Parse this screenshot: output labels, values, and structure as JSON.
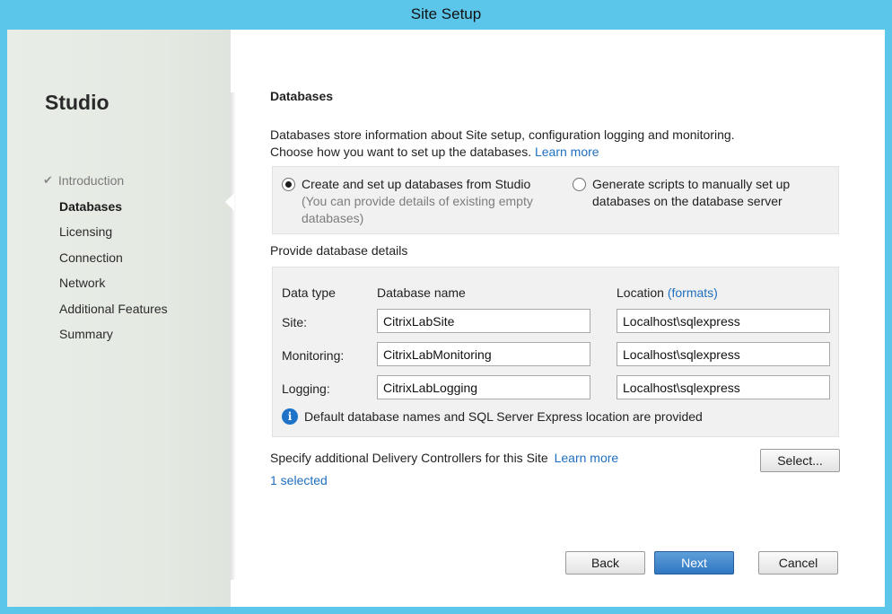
{
  "window": {
    "title": "Site Setup"
  },
  "sidebar": {
    "brand": "Studio",
    "items": [
      {
        "label": "Introduction",
        "state": "done"
      },
      {
        "label": "Databases",
        "state": "active"
      },
      {
        "label": "Licensing",
        "state": "pending"
      },
      {
        "label": "Connection",
        "state": "pending"
      },
      {
        "label": "Network",
        "state": "pending"
      },
      {
        "label": "Additional Features",
        "state": "pending"
      },
      {
        "label": "Summary",
        "state": "pending"
      }
    ],
    "check_glyph": "✔"
  },
  "main": {
    "title": "Databases",
    "intro_line1": "Databases store information about Site setup, configuration logging and monitoring.",
    "intro_line2": "Choose how you want to set up the databases.",
    "intro_link": "Learn more",
    "options": [
      {
        "label": "Create and set up databases from Studio",
        "sub": "(You can provide details of existing empty databases)",
        "selected": true
      },
      {
        "label": "Generate scripts to manually set up databases on the database server",
        "selected": false
      }
    ],
    "details_label": "Provide database details",
    "table": {
      "headers": {
        "type": "Data type",
        "name": "Database name",
        "location": "Location",
        "formats_link": "(formats)"
      },
      "rows": [
        {
          "label": "Site:",
          "name": "CitrixLabSite",
          "location": "Localhost\\sqlexpress"
        },
        {
          "label": "Monitoring:",
          "name": "CitrixLabMonitoring",
          "location": "Localhost\\sqlexpress"
        },
        {
          "label": "Logging:",
          "name": "CitrixLabLogging",
          "location": "Localhost\\sqlexpress"
        }
      ],
      "info": "Default database names and SQL Server Express location are provided",
      "info_glyph": "i"
    },
    "controllers_label": "Specify additional Delivery Controllers for this Site",
    "controllers_link": "Learn more",
    "select_button": "Select...",
    "selected_count": "1 selected"
  },
  "footer": {
    "back": "Back",
    "next": "Next",
    "cancel": "Cancel"
  },
  "colors": {
    "frame": "#5bc6ea",
    "link": "#1f6fbf",
    "primary": "#2f77c2",
    "panel": "#f1f1f1"
  },
  "icons": {
    "check": "check-icon",
    "info": "info-icon"
  }
}
